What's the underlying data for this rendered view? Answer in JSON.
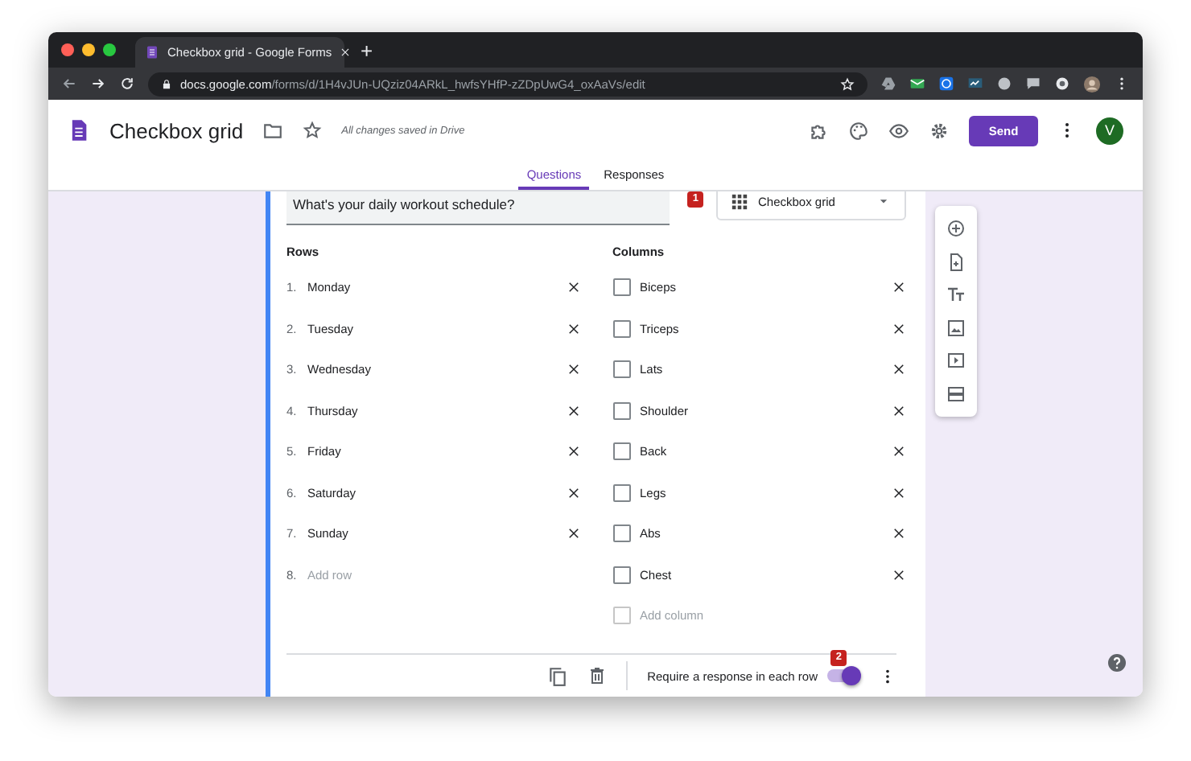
{
  "browser": {
    "tab_title": "Checkbox grid - Google Forms",
    "new_tab": "+",
    "url_host": "docs.google.com",
    "url_path": "/forms/d/1H4vJUn-UQziz04ARkL_hwfsYHfP-zZDpUwG4_oxAaVs/edit"
  },
  "header": {
    "title": "Checkbox grid",
    "save_status": "All changes saved in Drive",
    "send": "Send",
    "avatar": "V"
  },
  "tabs": [
    {
      "label": "Questions",
      "selected": true
    },
    {
      "label": "Responses",
      "selected": false
    }
  ],
  "question": {
    "text": "What's your daily workout schedule?",
    "type_badge": "1",
    "type": "Checkbox grid",
    "rows_heading": "Rows",
    "rows": [
      {
        "number": "1.",
        "label": "Monday"
      },
      {
        "number": "2.",
        "label": "Tuesday"
      },
      {
        "number": "3.",
        "label": "Wednesday"
      },
      {
        "number": "4.",
        "label": "Thursday"
      },
      {
        "number": "5.",
        "label": "Friday"
      },
      {
        "number": "6.",
        "label": "Saturday"
      },
      {
        "number": "7.",
        "label": "Sunday"
      }
    ],
    "add_row_number": "8.",
    "add_row": "Add row",
    "columns_heading": "Columns",
    "columns": [
      {
        "label": "Biceps",
        "checked": false
      },
      {
        "label": "Triceps",
        "checked": false
      },
      {
        "label": "Lats",
        "checked": false
      },
      {
        "label": "Shoulder",
        "checked": false
      },
      {
        "label": "Back",
        "checked": false
      },
      {
        "label": "Legs",
        "checked": false
      },
      {
        "label": "Abs",
        "checked": false
      },
      {
        "label": "Chest",
        "checked": false
      }
    ],
    "add_column": "Add column",
    "add_column_checked": false,
    "require_badge": "2",
    "require_label": "Require a response in each row",
    "require_on": true
  }
}
